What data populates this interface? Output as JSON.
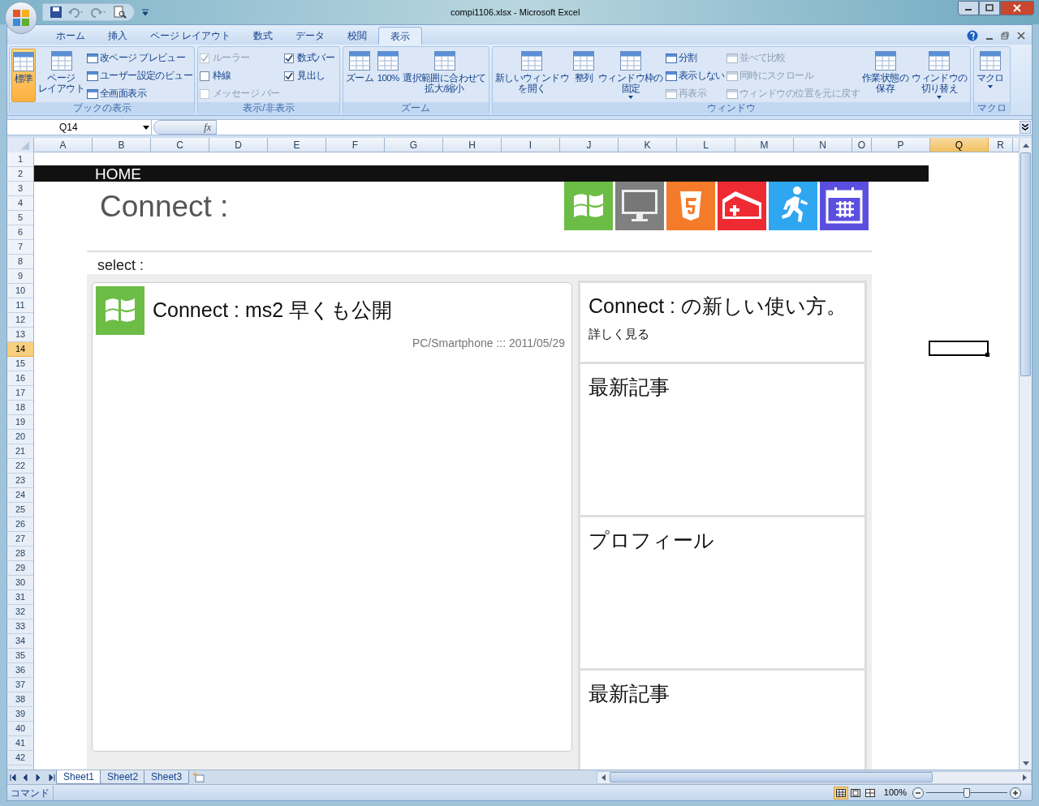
{
  "window": {
    "title": "compi1106.xlsx - Microsoft Excel"
  },
  "ribbon_tabs": [
    {
      "label": "ホーム",
      "selected": false
    },
    {
      "label": "挿入",
      "selected": false
    },
    {
      "label": "ページ レイアウト",
      "selected": false
    },
    {
      "label": "数式",
      "selected": false
    },
    {
      "label": "データ",
      "selected": false
    },
    {
      "label": "校閲",
      "selected": false
    },
    {
      "label": "表示",
      "selected": true
    }
  ],
  "ribbon_groups": [
    {
      "label": "ブックの表示",
      "columns": [
        [
          {
            "kind": "large",
            "label": "標準",
            "selected": true
          }
        ],
        [
          {
            "kind": "large",
            "label": [
              "ページ",
              "レイアウト"
            ],
            "selected": false
          }
        ],
        [
          {
            "kind": "small",
            "label": "改ページ プレビュー",
            "disabled": false
          },
          {
            "kind": "small",
            "label": "ユーザー設定のビュー",
            "disabled": false
          },
          {
            "kind": "small",
            "label": "全画面表示",
            "disabled": false
          }
        ]
      ]
    },
    {
      "label": "表示/非表示",
      "columns": [
        [
          {
            "kind": "check",
            "label": "ルーラー",
            "checked": true,
            "disabled": true
          },
          {
            "kind": "check",
            "label": "枠線",
            "checked": false,
            "disabled": false
          },
          {
            "kind": "check",
            "label": "メッセージ バー",
            "checked": false,
            "disabled": true
          }
        ],
        [
          {
            "kind": "check",
            "label": "数式バー",
            "checked": true,
            "disabled": false
          },
          {
            "kind": "check",
            "label": "見出し",
            "checked": true,
            "disabled": false
          }
        ]
      ]
    },
    {
      "label": "ズーム",
      "columns": [
        [
          {
            "kind": "large",
            "label": "ズーム",
            "selected": false
          }
        ],
        [
          {
            "kind": "large",
            "label": "100%",
            "selected": false
          }
        ],
        [
          {
            "kind": "large",
            "label": [
              "選択範囲に合わせて",
              "拡大/縮小"
            ],
            "selected": false
          }
        ]
      ]
    },
    {
      "label": "ウィンドウ",
      "columns": [
        [
          {
            "kind": "large",
            "label": [
              "新しいウィンドウ",
              "を開く"
            ],
            "selected": false
          }
        ],
        [
          {
            "kind": "large",
            "label": "整列",
            "selected": false
          }
        ],
        [
          {
            "kind": "large",
            "label": [
              "ウィンドウ枠の",
              "固定"
            ],
            "selected": false,
            "dropdown": true
          }
        ],
        [
          {
            "kind": "small",
            "label": "分割",
            "disabled": false
          },
          {
            "kind": "small",
            "label": "表示しない",
            "disabled": false
          },
          {
            "kind": "small",
            "label": "再表示",
            "disabled": true
          }
        ],
        [
          {
            "kind": "small",
            "label": "並べて比較",
            "disabled": true
          },
          {
            "kind": "small",
            "label": "同時にスクロール",
            "disabled": true
          },
          {
            "kind": "small",
            "label": "ウィンドウの位置を元に戻す",
            "disabled": true
          }
        ],
        [
          {
            "kind": "large",
            "label": [
              "作業状態の",
              "保存"
            ],
            "selected": false
          }
        ],
        [
          {
            "kind": "large",
            "label": [
              "ウィンドウの",
              "切り替え"
            ],
            "selected": false,
            "dropdown": true
          }
        ]
      ]
    },
    {
      "label": "マクロ",
      "columns": [
        [
          {
            "kind": "large",
            "label": "マクロ",
            "selected": false,
            "dropdown": true
          }
        ]
      ]
    }
  ],
  "formula_bar": {
    "name_box": "Q14",
    "fx": "fx"
  },
  "columns": [
    {
      "label": "A",
      "selected": false
    },
    {
      "label": "B",
      "selected": false
    },
    {
      "label": "C",
      "selected": false
    },
    {
      "label": "D",
      "selected": false
    },
    {
      "label": "E",
      "selected": false
    },
    {
      "label": "F",
      "selected": false
    },
    {
      "label": "G",
      "selected": false
    },
    {
      "label": "H",
      "selected": false
    },
    {
      "label": "I",
      "selected": false
    },
    {
      "label": "J",
      "selected": false
    },
    {
      "label": "K",
      "selected": false
    },
    {
      "label": "L",
      "selected": false
    },
    {
      "label": "M",
      "selected": false
    },
    {
      "label": "N",
      "selected": false
    },
    {
      "label": "O",
      "selected": false
    },
    {
      "label": "P",
      "selected": false
    },
    {
      "label": "Q",
      "selected": true
    },
    {
      "label": "R",
      "selected": false
    }
  ],
  "rows": [
    {
      "label": "1",
      "selected": false
    },
    {
      "label": "2",
      "selected": false
    },
    {
      "label": "3",
      "selected": false
    },
    {
      "label": "4",
      "selected": false
    },
    {
      "label": "5",
      "selected": false
    },
    {
      "label": "6",
      "selected": false
    },
    {
      "label": "7",
      "selected": false
    },
    {
      "label": "8",
      "selected": false
    },
    {
      "label": "9",
      "selected": false
    },
    {
      "label": "10",
      "selected": false
    },
    {
      "label": "11",
      "selected": false
    },
    {
      "label": "12",
      "selected": false
    },
    {
      "label": "13",
      "selected": false
    },
    {
      "label": "14",
      "selected": true
    },
    {
      "label": "15",
      "selected": false
    },
    {
      "label": "16",
      "selected": false
    },
    {
      "label": "17",
      "selected": false
    },
    {
      "label": "18",
      "selected": false
    },
    {
      "label": "19",
      "selected": false
    },
    {
      "label": "20",
      "selected": false
    },
    {
      "label": "21",
      "selected": false
    },
    {
      "label": "22",
      "selected": false
    },
    {
      "label": "23",
      "selected": false
    },
    {
      "label": "24",
      "selected": false
    },
    {
      "label": "25",
      "selected": false
    },
    {
      "label": "26",
      "selected": false
    },
    {
      "label": "27",
      "selected": false
    },
    {
      "label": "28",
      "selected": false
    },
    {
      "label": "29",
      "selected": false
    },
    {
      "label": "30",
      "selected": false
    },
    {
      "label": "31",
      "selected": false
    },
    {
      "label": "32",
      "selected": false
    },
    {
      "label": "33",
      "selected": false
    },
    {
      "label": "34",
      "selected": false
    },
    {
      "label": "35",
      "selected": false
    },
    {
      "label": "36",
      "selected": false
    },
    {
      "label": "37",
      "selected": false
    },
    {
      "label": "38",
      "selected": false
    },
    {
      "label": "39",
      "selected": false
    },
    {
      "label": "40",
      "selected": false
    },
    {
      "label": "41",
      "selected": false
    },
    {
      "label": "42",
      "selected": false
    }
  ],
  "sheet": {
    "header_bar": "HOME",
    "page_title": "Connect :",
    "tiles": [
      {
        "kind": "windows",
        "color": "#6cbd45"
      },
      {
        "kind": "monitor",
        "color": "#808080"
      },
      {
        "kind": "html5",
        "color": "#f47b2a"
      },
      {
        "kind": "ambulance",
        "color": "#ee2a32"
      },
      {
        "kind": "runner",
        "color": "#2ea7f0"
      },
      {
        "kind": "calendar",
        "color": "#5b4fe0"
      }
    ],
    "select_label": "select :",
    "post": {
      "title": "Connect : ms2 早くも公開",
      "meta": "PC/Smartphone ::: 2011/05/29"
    },
    "side_boxes": [
      {
        "title": "Connect : の新しい使い方。",
        "link": "詳しく見る"
      },
      {
        "title": "最新記事"
      },
      {
        "title": "プロフィール"
      },
      {
        "title": "最新記事"
      }
    ]
  },
  "sheet_tabs": [
    {
      "label": "Sheet1",
      "selected": true
    },
    {
      "label": "Sheet2",
      "selected": false
    },
    {
      "label": "Sheet3",
      "selected": false
    }
  ],
  "status_bar": {
    "mode": "コマンド",
    "views": [
      {
        "selected": true
      },
      {
        "selected": false
      },
      {
        "selected": false
      }
    ],
    "zoom": "100%",
    "level": 0.5
  }
}
